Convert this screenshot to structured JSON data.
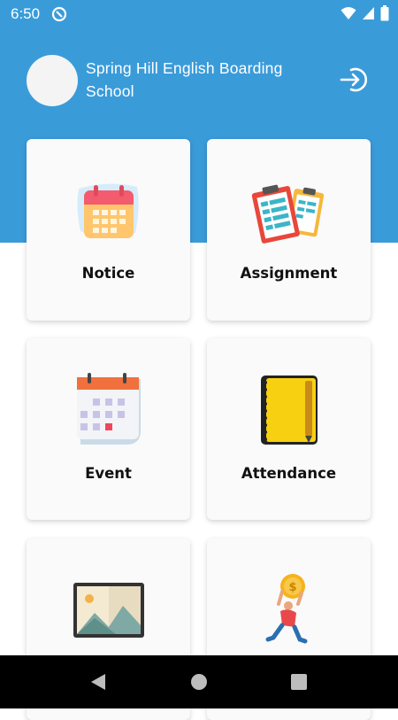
{
  "status_bar": {
    "time": "6:50",
    "icons": [
      "app-notification-icon",
      "wifi-icon",
      "signal-icon",
      "battery-icon"
    ]
  },
  "header": {
    "school_name": "Spring Hill English Boarding School",
    "background_color": "#3a9bd9",
    "avatar_icon": "avatar",
    "logout_icon": "logout-icon"
  },
  "menu": {
    "items": [
      {
        "label": "Notice",
        "icon": "calendar-icon"
      },
      {
        "label": "Assignment",
        "icon": "clipboard-icon"
      },
      {
        "label": "Event",
        "icon": "event-calendar-icon"
      },
      {
        "label": "Attendance",
        "icon": "notebook-icon"
      },
      {
        "label": "",
        "icon": "gallery-icon"
      },
      {
        "label": "",
        "icon": "fee-coin-icon"
      }
    ]
  },
  "nav_bar": {
    "buttons": [
      "back-icon",
      "home-icon",
      "recents-icon"
    ]
  }
}
